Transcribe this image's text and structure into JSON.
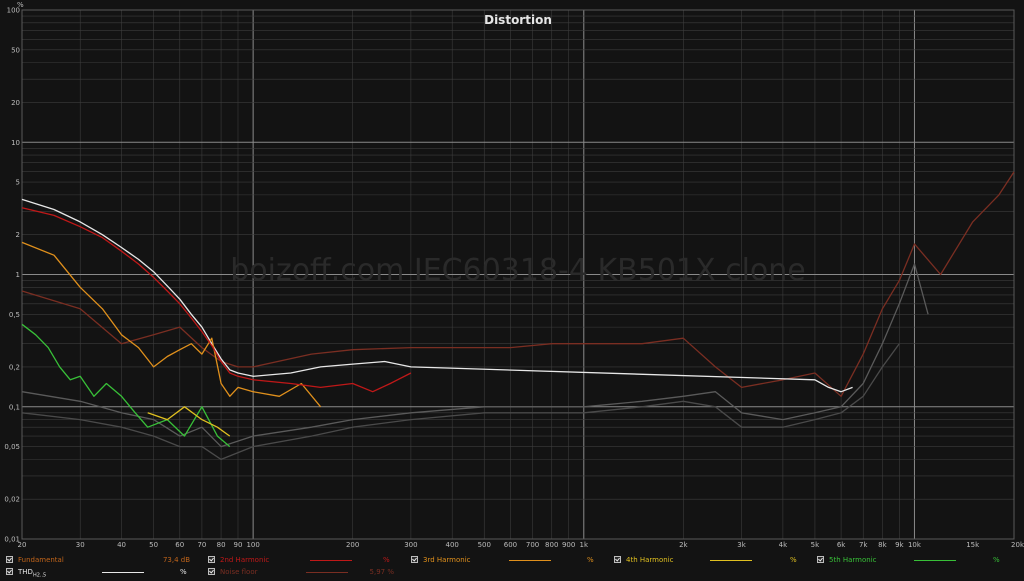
{
  "chart_data": {
    "type": "line",
    "title": "Distortion",
    "watermark": "boizoff.com IEC60318-4 KB501X clone",
    "ylabel": "%",
    "xlim": [
      20,
      20000
    ],
    "ylim": [
      0.01,
      100
    ],
    "x_scale": "log",
    "y_scale": "log",
    "grid": true,
    "y_ticks": [
      {
        "v": 100,
        "label": "100"
      },
      {
        "v": 50,
        "label": "50"
      },
      {
        "v": 20,
        "label": "20"
      },
      {
        "v": 10,
        "label": "10"
      },
      {
        "v": 5,
        "label": "5"
      },
      {
        "v": 2,
        "label": "2"
      },
      {
        "v": 1,
        "label": "1"
      },
      {
        "v": 0.5,
        "label": "0,5"
      },
      {
        "v": 0.2,
        "label": "0,2"
      },
      {
        "v": 0.1,
        "label": "0,1"
      },
      {
        "v": 0.05,
        "label": "0,05"
      },
      {
        "v": 0.02,
        "label": "0,02"
      },
      {
        "v": 0.01,
        "label": "0,01"
      }
    ],
    "x_ticks": [
      {
        "v": 20,
        "label": "20"
      },
      {
        "v": 30,
        "label": "30"
      },
      {
        "v": 40,
        "label": "40"
      },
      {
        "v": 50,
        "label": "50"
      },
      {
        "v": 60,
        "label": "60"
      },
      {
        "v": 70,
        "label": "70"
      },
      {
        "v": 80,
        "label": "80"
      },
      {
        "v": 90,
        "label": "90"
      },
      {
        "v": 100,
        "label": "100"
      },
      {
        "v": 200,
        "label": "200"
      },
      {
        "v": 300,
        "label": "300"
      },
      {
        "v": 400,
        "label": "400"
      },
      {
        "v": 500,
        "label": "500"
      },
      {
        "v": 600,
        "label": "600"
      },
      {
        "v": 700,
        "label": "700"
      },
      {
        "v": 800,
        "label": "800"
      },
      {
        "v": 900,
        "label": "900"
      },
      {
        "v": 1000,
        "label": "1k"
      },
      {
        "v": 2000,
        "label": "2k"
      },
      {
        "v": 3000,
        "label": "3k"
      },
      {
        "v": 4000,
        "label": "4k"
      },
      {
        "v": 5000,
        "label": "5k"
      },
      {
        "v": 6000,
        "label": "6k"
      },
      {
        "v": 7000,
        "label": "7k"
      },
      {
        "v": 8000,
        "label": "8k"
      },
      {
        "v": 9000,
        "label": "9k"
      },
      {
        "v": 10000,
        "label": "10k"
      },
      {
        "v": 15000,
        "label": "15k"
      },
      {
        "v": 20000,
        "label": "20kHz"
      }
    ],
    "series": [
      {
        "name": "Fundamental",
        "color": "#c0641a",
        "legend_value": "73,4 dB",
        "x": [],
        "y": []
      },
      {
        "name": "2nd Harmonic",
        "color": "#c01818",
        "legend_unit": "%",
        "x": [
          20,
          25,
          30,
          35,
          40,
          45,
          50,
          55,
          60,
          65,
          70,
          75,
          80,
          85,
          90,
          100,
          130,
          160,
          200,
          230,
          260,
          300
        ],
        "y": [
          3.2,
          2.8,
          2.3,
          1.9,
          1.5,
          1.2,
          0.95,
          0.75,
          0.6,
          0.47,
          0.37,
          0.29,
          0.22,
          0.18,
          0.17,
          0.16,
          0.15,
          0.14,
          0.15,
          0.13,
          0.15,
          0.18
        ]
      },
      {
        "name": "3rd Harmonic",
        "color": "#e0901c",
        "legend_unit": "%",
        "x": [
          20,
          25,
          30,
          35,
          40,
          45,
          50,
          55,
          60,
          65,
          70,
          75,
          80,
          85,
          90,
          100,
          120,
          140,
          160
        ],
        "y": [
          1.75,
          1.4,
          0.8,
          0.55,
          0.35,
          0.28,
          0.2,
          0.24,
          0.27,
          0.3,
          0.25,
          0.33,
          0.15,
          0.12,
          0.14,
          0.13,
          0.12,
          0.15,
          0.1
        ]
      },
      {
        "name": "4th Harmonic",
        "color": "#e0c020",
        "legend_unit": "%",
        "x": [
          48,
          55,
          62,
          70,
          78,
          85
        ],
        "y": [
          0.09,
          0.08,
          0.1,
          0.08,
          0.07,
          0.06
        ]
      },
      {
        "name": "5th Harmonic",
        "color": "#38c038",
        "legend_unit": "%",
        "x": [
          20,
          22,
          24,
          26,
          28,
          30,
          33,
          36,
          40,
          44,
          48,
          55,
          62,
          70,
          78,
          85
        ],
        "y": [
          0.42,
          0.35,
          0.28,
          0.2,
          0.16,
          0.17,
          0.12,
          0.15,
          0.12,
          0.09,
          0.07,
          0.08,
          0.06,
          0.1,
          0.06,
          0.05
        ]
      },
      {
        "name": "THD",
        "name_sub": "H2..5",
        "color": "#e8e8e8",
        "legend_unit": "%",
        "x": [
          20,
          25,
          30,
          35,
          40,
          45,
          50,
          55,
          60,
          65,
          70,
          75,
          80,
          85,
          90,
          100,
          130,
          160,
          200,
          250,
          300,
          5000,
          5500,
          6000,
          6500
        ],
        "y": [
          3.7,
          3.1,
          2.5,
          2.0,
          1.6,
          1.3,
          1.05,
          0.82,
          0.65,
          0.5,
          0.4,
          0.3,
          0.23,
          0.19,
          0.18,
          0.17,
          0.18,
          0.2,
          0.21,
          0.22,
          0.2,
          0.16,
          0.14,
          0.13,
          0.14
        ]
      },
      {
        "name": "Noise floor",
        "color": "#7a2e22",
        "legend_value": "5,97 %",
        "x": [
          20,
          30,
          40,
          50,
          60,
          70,
          80,
          90,
          100,
          150,
          200,
          300,
          400,
          600,
          800,
          1000,
          1500,
          2000,
          2500,
          3000,
          4000,
          5000,
          6000,
          7000,
          8000,
          9000,
          10000,
          12000,
          15000,
          18000,
          20000
        ],
        "y": [
          0.75,
          0.55,
          0.3,
          0.35,
          0.4,
          0.28,
          0.22,
          0.2,
          0.2,
          0.25,
          0.27,
          0.28,
          0.28,
          0.28,
          0.3,
          0.3,
          0.3,
          0.33,
          0.2,
          0.14,
          0.16,
          0.18,
          0.12,
          0.25,
          0.55,
          0.9,
          1.7,
          1.0,
          2.5,
          4.0,
          5.97
        ]
      },
      {
        "name": "",
        "color": "#5a5a5a",
        "x": [
          20,
          30,
          40,
          50,
          60,
          70,
          80,
          100,
          150,
          200,
          300,
          500,
          700,
          1000,
          1500,
          2000,
          2500,
          3000,
          4000,
          5000,
          6000,
          7000,
          8000,
          9000,
          10000,
          11000
        ],
        "y": [
          0.13,
          0.11,
          0.09,
          0.08,
          0.06,
          0.07,
          0.05,
          0.06,
          0.07,
          0.08,
          0.09,
          0.1,
          0.1,
          0.1,
          0.11,
          0.12,
          0.13,
          0.09,
          0.08,
          0.09,
          0.1,
          0.15,
          0.3,
          0.6,
          1.2,
          0.5
        ]
      },
      {
        "name": "",
        "color": "#4a4a4a",
        "x": [
          20,
          30,
          40,
          50,
          60,
          70,
          80,
          100,
          150,
          200,
          300,
          500,
          700,
          1000,
          1500,
          2000,
          2500,
          3000,
          4000,
          5000,
          6000,
          7000,
          8000,
          9000
        ],
        "y": [
          0.09,
          0.08,
          0.07,
          0.06,
          0.05,
          0.05,
          0.04,
          0.05,
          0.06,
          0.07,
          0.08,
          0.09,
          0.09,
          0.09,
          0.1,
          0.11,
          0.1,
          0.07,
          0.07,
          0.08,
          0.09,
          0.12,
          0.2,
          0.3
        ]
      }
    ]
  },
  "legend": {
    "row1": [
      {
        "name": "Fundamental",
        "color": "#c0641a",
        "value": "73,4 dB",
        "unit": ""
      },
      {
        "name": "2nd Harmonic",
        "color": "#c01818",
        "value": "",
        "unit": "%"
      },
      {
        "name": "3rd Harmonic",
        "color": "#e0901c",
        "value": "",
        "unit": "%"
      },
      {
        "name": "4th Harmonic",
        "color": "#e0c020",
        "value": "",
        "unit": "%"
      },
      {
        "name": "5th Harmonic",
        "color": "#38c038",
        "value": "",
        "unit": "%"
      }
    ],
    "row2": [
      {
        "name": "THD",
        "sub": "H2..5",
        "color": "#e8e8e8",
        "value": "",
        "unit": "%"
      },
      {
        "name": "Noise floor",
        "color": "#7a2e22",
        "value": "5,97 %",
        "unit": ""
      }
    ]
  }
}
